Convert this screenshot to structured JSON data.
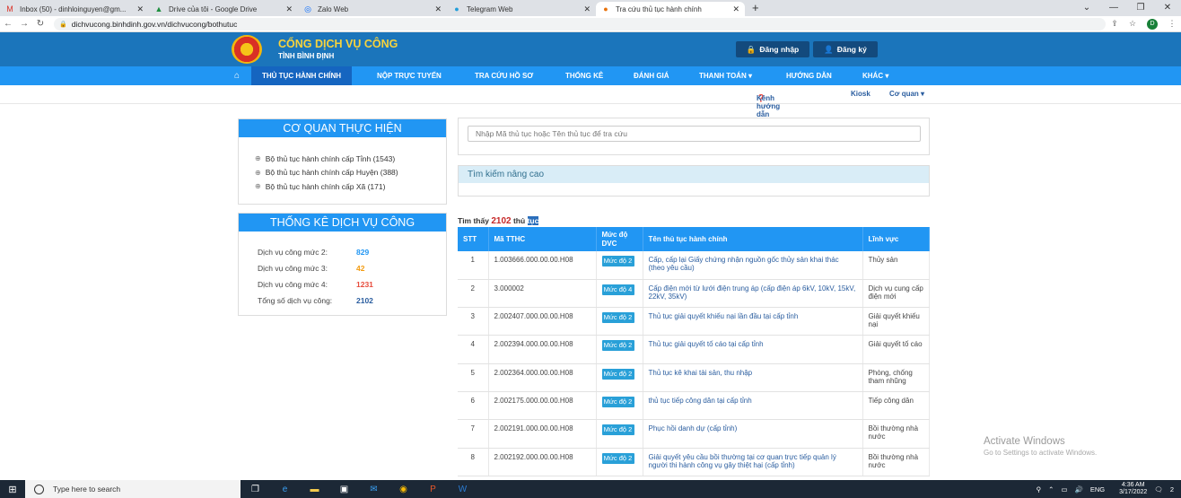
{
  "browser": {
    "tabs": [
      {
        "label": "Inbox (50) - dinhloinguyen@gm...",
        "icon": "gmail-icon"
      },
      {
        "label": "Drive của tôi - Google Drive",
        "icon": "drive-icon"
      },
      {
        "label": "Zalo Web",
        "icon": "zalo-icon"
      },
      {
        "label": "Telegram Web",
        "icon": "telegram-icon"
      },
      {
        "label": "Tra cứu thủ tục hành chính",
        "icon": "site-icon"
      }
    ],
    "url": "dichvucong.binhdinh.gov.vn/dichvucong/bothutuc",
    "profile": "D"
  },
  "header": {
    "title": "CỔNG DỊCH VỤ CÔNG",
    "subtitle": "TỈNH BÌNH ĐỊNH",
    "login": "Đăng nhập",
    "register": "Đăng ký"
  },
  "menu": [
    {
      "label": "THỦ TỤC HÀNH CHÍNH"
    },
    {
      "label": "NỘP TRỰC TUYẾN"
    },
    {
      "label": "TRA CỨU HỒ SƠ"
    },
    {
      "label": "THỐNG KÊ"
    },
    {
      "label": "ĐÁNH GIÁ"
    },
    {
      "label": "THANH TOÁN ▾"
    },
    {
      "label": "HƯỚNG DẪN"
    },
    {
      "label": "KHÁC ▾"
    }
  ],
  "sub_links": {
    "guide": "Kênh hướng dẫn",
    "kiosk": "Kiosk",
    "agency": "Cơ quan ▾"
  },
  "agency_panel": {
    "title": "CƠ QUAN THỰC HIỆN",
    "items": [
      "Bộ thủ tục hành chính cấp Tỉnh (1543)",
      "Bộ thủ tục hành chính cấp Huyện (388)",
      "Bộ thủ tục hành chính cấp Xã (171)"
    ]
  },
  "stats_panel": {
    "title": "THỐNG KÊ DỊCH VỤ CÔNG",
    "rows": [
      {
        "label": "Dịch vụ công mức 2:",
        "value": "829",
        "color": "#2196f3"
      },
      {
        "label": "Dịch vụ công mức 3:",
        "value": "42",
        "color": "#f39c12"
      },
      {
        "label": "Dịch vụ công mức 4:",
        "value": "1231",
        "color": "#e74c3c"
      },
      {
        "label": "Tổng số dịch vụ công:",
        "value": "2102",
        "color": "#2a5d9f"
      }
    ]
  },
  "search": {
    "placeholder": "Nhập Mã thủ tục hoặc Tên thủ tục để tra cứu",
    "advanced": "Tìm kiếm nâng cao"
  },
  "results": {
    "prefix": "Tìm thấy",
    "count": "2102",
    "suffix1": "thủ",
    "suffix2": "tục"
  },
  "table": {
    "headers": [
      "STT",
      "Mã TTHC",
      "Mức độ DVC",
      "Tên thủ tục hành chính",
      "Lĩnh vực"
    ],
    "rows": [
      {
        "stt": "1",
        "code": "1.003666.000.00.00.H08",
        "level": "Mức độ 2",
        "name": "Cấp, cấp lại Giấy chứng nhận nguồn gốc thủy sản khai thác (theo yêu cầu)",
        "field": "Thủy sản"
      },
      {
        "stt": "2",
        "code": "3.000002",
        "level": "Mức độ 4",
        "name": "Cấp điện mới từ lưới điện trung áp (cấp điện áp 6kV, 10kV, 15kV, 22kV, 35kV)",
        "field": "Dịch vụ cung cấp điện mới"
      },
      {
        "stt": "3",
        "code": "2.002407.000.00.00.H08",
        "level": "Mức độ 2",
        "name": "Thủ tục giải quyết khiếu nại lần đầu tại cấp tỉnh",
        "field": "Giải quyết khiếu nại"
      },
      {
        "stt": "4",
        "code": "2.002394.000.00.00.H08",
        "level": "Mức độ 2",
        "name": "Thủ tục giải quyết tố cáo tại cấp tỉnh",
        "field": "Giải quyết tố cáo"
      },
      {
        "stt": "5",
        "code": "2.002364.000.00.00.H08",
        "level": "Mức độ 2",
        "name": "Thủ tục kê khai tài sản, thu nhập",
        "field": "Phòng, chống tham nhũng"
      },
      {
        "stt": "6",
        "code": "2.002175.000.00.00.H08",
        "level": "Mức độ 2",
        "name": "thủ tục tiếp công dân tại cấp tỉnh",
        "field": "Tiếp công dân"
      },
      {
        "stt": "7",
        "code": "2.002191.000.00.00.H08",
        "level": "Mức độ 2",
        "name": "Phục hồi danh dự (cấp tỉnh)",
        "field": "Bồi thường nhà nước"
      },
      {
        "stt": "8",
        "code": "2.002192.000.00.00.H08",
        "level": "Mức độ 2",
        "name": "Giải quyết yêu cầu bồi thường tại cơ quan trực tiếp quản lý người thi hành công vụ gây thiệt hại (cấp tỉnh)",
        "field": "Bồi thường nhà nước"
      }
    ]
  },
  "watermark": {
    "line1": "Activate Windows",
    "line2": "Go to Settings to activate Windows."
  },
  "taskbar": {
    "search": "Type here to search",
    "lang": "ENG",
    "time": "4:36 AM",
    "date": "3/17/2022",
    "notif": "2"
  }
}
